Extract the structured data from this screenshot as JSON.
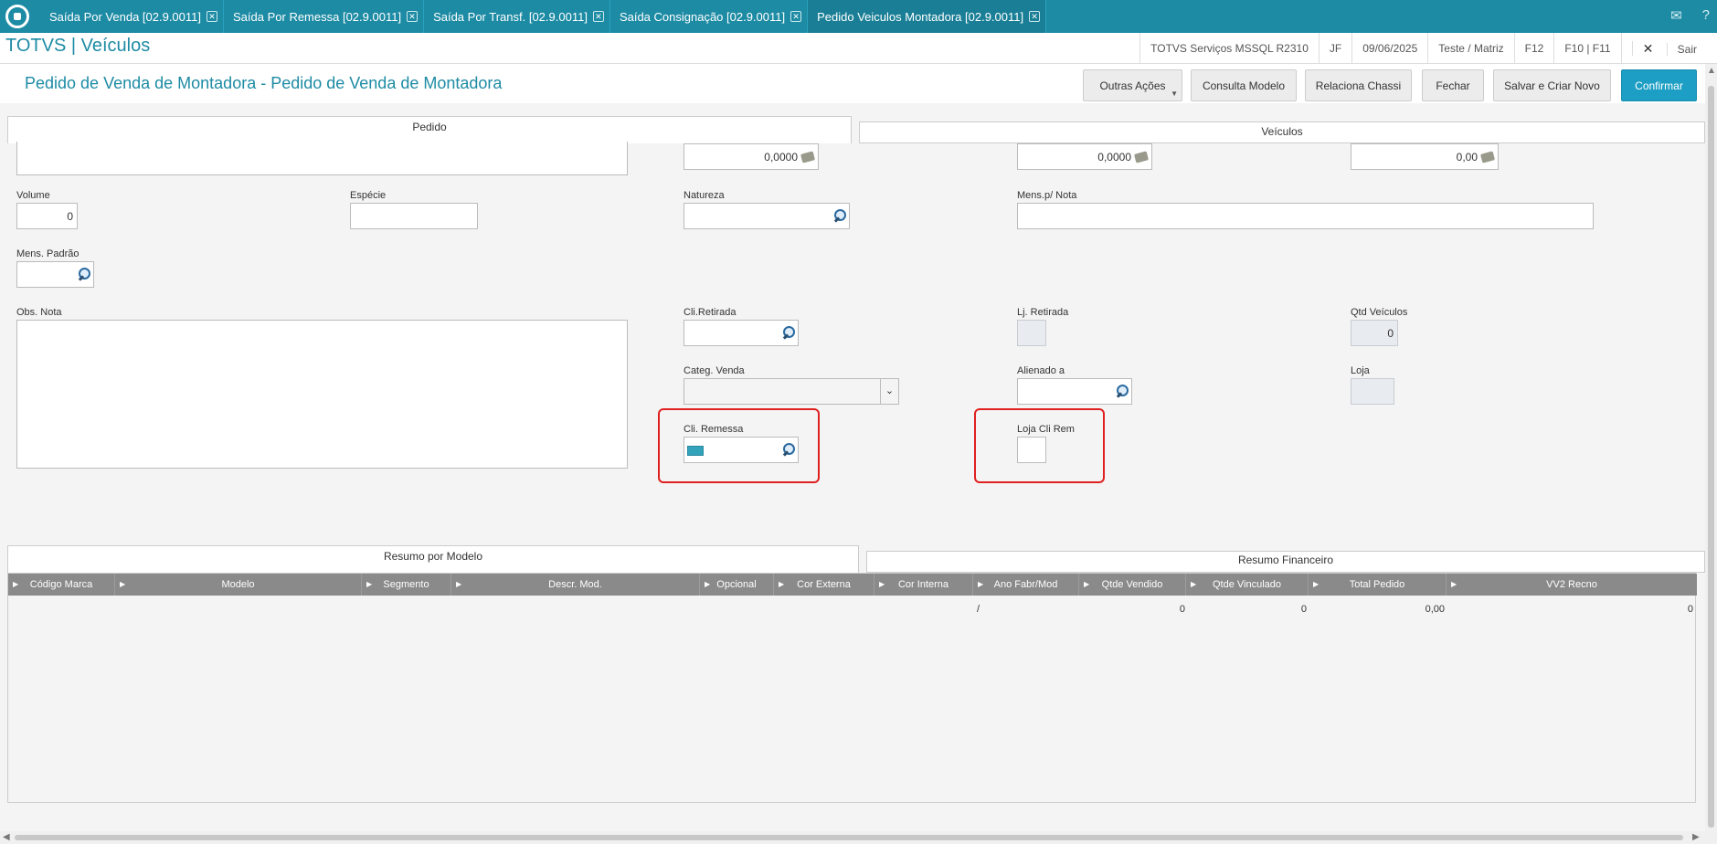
{
  "tabs": [
    {
      "label": "Saída Por Venda [02.9.0011]"
    },
    {
      "label": "Saída Por Remessa [02.9.0011]"
    },
    {
      "label": "Saída Por Transf. [02.9.0011]"
    },
    {
      "label": "Saída Consignação [02.9.0011]"
    },
    {
      "label": "Pedido Veiculos Montadora [02.9.0011]"
    }
  ],
  "brand": "TOTVS | Veículos",
  "status": {
    "environment": "TOTVS Serviços MSSQL R2310",
    "user": "JF",
    "date": "09/06/2025",
    "branch": "Teste / Matriz",
    "key1": "F12",
    "key2": "F10 | F11",
    "exit": "Sair"
  },
  "form": {
    "title": "Pedido de Venda de Montadora - Pedido de Venda de Montadora",
    "buttons": {
      "outras": "Outras Ações",
      "consulta": "Consulta Modelo",
      "relaciona": "Relaciona Chassi",
      "fechar": "Fechar",
      "salvar": "Salvar e Criar Novo",
      "confirmar": "Confirmar"
    }
  },
  "folder_tabs": {
    "pedido": "Pedido",
    "veiculos": "Veículos"
  },
  "fields": {
    "top_value1": "0,0000",
    "top_value2": "0,0000",
    "top_value3": "0,00",
    "volume_label": "Volume",
    "volume_value": "0",
    "especie_label": "Espécie",
    "natureza_label": "Natureza",
    "mens_nota_label": "Mens.p/ Nota",
    "mens_padrao_label": "Mens. Padrão",
    "obs_nota_label": "Obs. Nota",
    "cli_retirada_label": "Cli.Retirada",
    "lj_retirada_label": "Lj. Retirada",
    "qtd_veiculos_label": "Qtd Veículos",
    "qtd_veiculos_value": "0",
    "categ_venda_label": "Categ. Venda",
    "alienado_label": "Alienado a",
    "loja_label": "Loja",
    "cli_remessa_label": "Cli. Remessa",
    "loja_cli_rem_label": "Loja Cli Rem"
  },
  "bottom_tabs": {
    "resumo_modelo": "Resumo por Modelo",
    "resumo_financeiro": "Resumo Financeiro"
  },
  "grid": {
    "columns": [
      "Código Marca",
      "Modelo",
      "Segmento",
      "Descr. Mod.",
      "Opcional",
      "Cor Externa",
      "Cor Interna",
      "Ano Fabr/Mod",
      "Qtde Vendido",
      "Qtde Vinculado",
      "Total Pedido",
      "VV2 Recno"
    ],
    "row": {
      "ano": "/",
      "qtde_vendido": "0",
      "qtde_vinculado": "0",
      "total_pedido": "0,00",
      "recno": "0"
    }
  },
  "colors": {
    "accent": "#1d8ba4",
    "primary_button": "#1d9ec4",
    "highlight": "#e02020"
  }
}
